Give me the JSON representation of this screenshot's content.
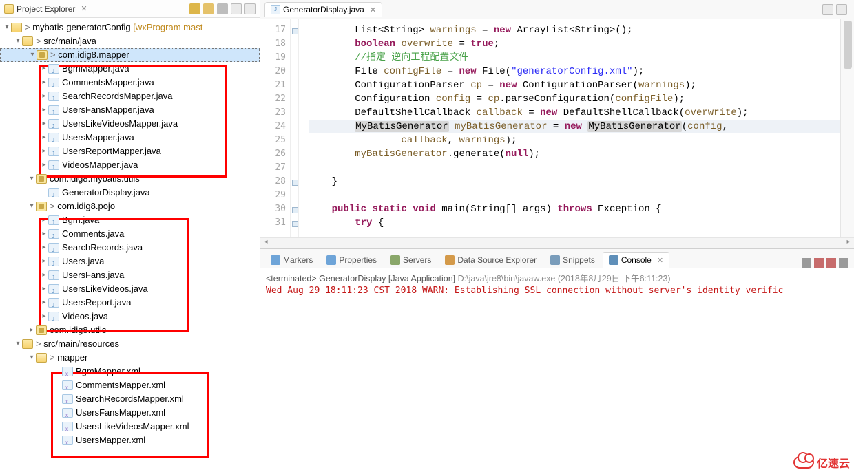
{
  "explorer": {
    "title": "Project Explorer",
    "project": {
      "name": "mybatis-generatorConfig",
      "branch": "[wxProgram mast"
    },
    "srcMain": "src/main/java",
    "srcRes": "src/main/resources",
    "pkgMapper": "com.idig8.mapper",
    "pkgUtils": "com.idig8.mybatis.utils",
    "pkgPojo": "com.idig8.pojo",
    "pkgUtilsShort": "com.idig8.utils",
    "folderMapper": "mapper",
    "genDisplay": "GeneratorDisplay.java",
    "mapperFiles": [
      "BgmMapper.java",
      "CommentsMapper.java",
      "SearchRecordsMapper.java",
      "UsersFansMapper.java",
      "UsersLikeVideosMapper.java",
      "UsersMapper.java",
      "UsersReportMapper.java",
      "VideosMapper.java"
    ],
    "pojoFiles": [
      "Bgm.java",
      "Comments.java",
      "SearchRecords.java",
      "Users.java",
      "UsersFans.java",
      "UsersLikeVideos.java",
      "UsersReport.java",
      "Videos.java"
    ],
    "xmlFiles": [
      "BgmMapper.xml",
      "CommentsMapper.xml",
      "SearchRecordsMapper.xml",
      "UsersFansMapper.xml",
      "UsersLikeVideosMapper.xml",
      "UsersMapper.xml"
    ]
  },
  "editor": {
    "tab": "GeneratorDisplay.java",
    "lineStart": 17,
    "lines": [
      {
        "n": 17,
        "h": "        List&lt;String&gt; <span class='var'>warnings</span> = <span class='kw'>new</span> ArrayList&lt;String&gt;();"
      },
      {
        "n": 18,
        "h": "        <span class='kw'>boolean</span> <span class='var'>overwrite</span> = <span class='kw'>true</span>;"
      },
      {
        "n": 19,
        "h": "        <span class='cm'>//指定 逆向工程配置文件</span>"
      },
      {
        "n": 20,
        "h": "        File <span class='var'>configFile</span> = <span class='kw'>new</span> File(<span class='str'>\"generatorConfig.xml\"</span>);"
      },
      {
        "n": 21,
        "h": "        ConfigurationParser <span class='var'>cp</span> = <span class='kw'>new</span> ConfigurationParser(<span class='var'>warnings</span>);"
      },
      {
        "n": 22,
        "h": "        Configuration <span class='var'>config</span> = <span class='var'>cp</span>.parseConfiguration(<span class='var'>configFile</span>);"
      },
      {
        "n": 23,
        "h": "        DefaultShellCallback <span class='var'>callback</span> = <span class='kw'>new</span> DefaultShellCallback(<span class='var'>overwrite</span>);"
      },
      {
        "n": 24,
        "hl": true,
        "h": "        <span class='sel-bg'>MyBatisGenerator</span> <span class='var'>myBatisGenerator</span> = <span class='kw'>new</span> <span class='sel-bg'>MyBatisGenerator</span>(<span class='var'>config</span>,"
      },
      {
        "n": 25,
        "h": "                <span class='var'>callback</span>, <span class='var'>warnings</span>);"
      },
      {
        "n": 26,
        "h": "        <span class='var'>myBatisGenerator</span>.generate(<span class='kw'>null</span>);"
      },
      {
        "n": 27,
        "h": ""
      },
      {
        "n": 28,
        "h": "    }"
      },
      {
        "n": 29,
        "h": ""
      },
      {
        "n": 30,
        "h": "    <span class='kw'>public</span> <span class='kw'>static</span> <span class='kw'>void</span> main(String[] args) <span class='kw'>throws</span> Exception {"
      },
      {
        "n": 31,
        "h": "        <span class='kw'>try</span> {"
      }
    ]
  },
  "bottom": {
    "tabs": [
      {
        "label": "Markers",
        "icon": "#6ea4d8"
      },
      {
        "label": "Properties",
        "icon": "#6ea4d8"
      },
      {
        "label": "Servers",
        "icon": "#8aa76a"
      },
      {
        "label": "Data Source Explorer",
        "icon": "#d49a4a"
      },
      {
        "label": "Snippets",
        "icon": "#7a9dbb"
      },
      {
        "label": "Console",
        "icon": "#5f8fb9",
        "active": true
      }
    ],
    "status_pre": "<terminated> GeneratorDisplay [Java Application] ",
    "status_path": "D:\\java\\jre8\\bin\\javaw.exe (2018年8月29日 下午6:11:23)",
    "line": "Wed Aug 29 18:11:23 CST 2018 WARN: Establishing SSL connection without server's identity verific"
  },
  "logo": "亿速云"
}
